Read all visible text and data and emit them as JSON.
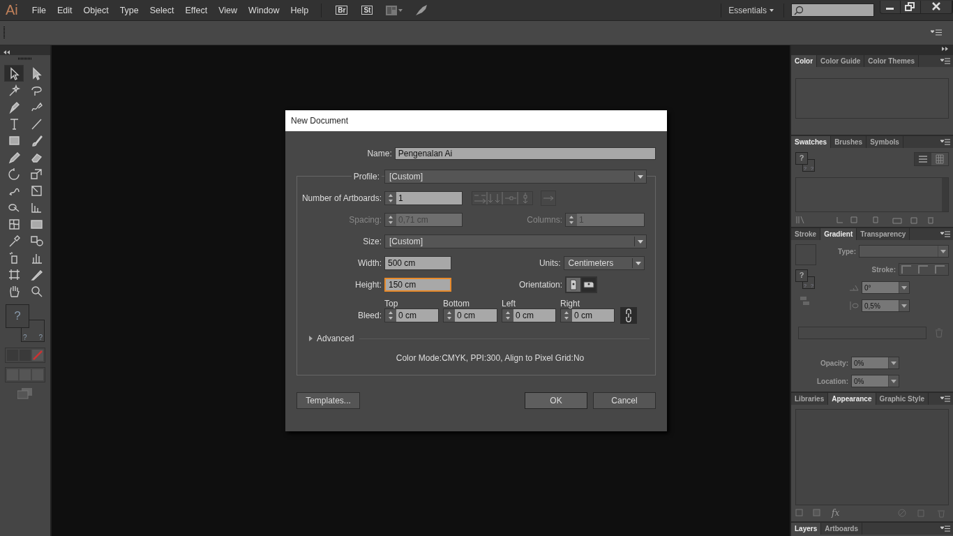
{
  "menubar": {
    "logo": "Ai",
    "menus": [
      "File",
      "Edit",
      "Object",
      "Type",
      "Select",
      "Effect",
      "View",
      "Window",
      "Help"
    ],
    "bridge": "Br",
    "stock": "St",
    "workspace": "Essentials"
  },
  "tools": [
    {
      "kind": "selection",
      "selected": true
    },
    {
      "kind": "direct",
      "selected": false
    },
    {
      "kind": "wand",
      "selected": false
    },
    {
      "kind": "lasso",
      "selected": false
    },
    {
      "kind": "pen",
      "selected": false
    },
    {
      "kind": "curvature",
      "selected": false
    },
    {
      "kind": "type",
      "selected": false
    },
    {
      "kind": "line",
      "selected": false
    },
    {
      "kind": "rectangle",
      "selected": false
    },
    {
      "kind": "brush",
      "selected": false
    },
    {
      "kind": "pencil",
      "selected": false
    },
    {
      "kind": "eraser",
      "selected": false
    },
    {
      "kind": "rotate",
      "selected": false
    },
    {
      "kind": "scale",
      "selected": false
    },
    {
      "kind": "warp",
      "selected": false
    },
    {
      "kind": "transform",
      "selected": false
    },
    {
      "kind": "shapebuilder",
      "selected": false
    },
    {
      "kind": "perspective",
      "selected": false
    },
    {
      "kind": "mesh",
      "selected": false
    },
    {
      "kind": "gradient",
      "selected": false
    },
    {
      "kind": "eyedropper",
      "selected": false
    },
    {
      "kind": "blend",
      "selected": false
    },
    {
      "kind": "sprayer",
      "selected": false
    },
    {
      "kind": "graph",
      "selected": false
    },
    {
      "kind": "artboard",
      "selected": false
    },
    {
      "kind": "slice",
      "selected": false
    },
    {
      "kind": "hand",
      "selected": false
    },
    {
      "kind": "zoom",
      "selected": false
    }
  ],
  "toolbox_fill": {
    "fill": "?",
    "stroke": "?",
    "other": "?"
  },
  "dialog": {
    "title": "New Document",
    "name": {
      "label": "Name:",
      "value": "Pengenalan Ai"
    },
    "profile": {
      "label": "Profile:",
      "value": "[Custom]"
    },
    "artboards": {
      "label": "Number of Artboards:",
      "value": "1"
    },
    "spacing": {
      "label": "Spacing:",
      "value": "0,71 cm",
      "disabled": true
    },
    "columns": {
      "label": "Columns:",
      "value": "1",
      "disabled": true
    },
    "size": {
      "label": "Size:",
      "value": "[Custom]"
    },
    "width": {
      "label": "Width:",
      "value": "500 cm"
    },
    "units": {
      "label": "Units:",
      "value": "Centimeters"
    },
    "height": {
      "label": "Height:",
      "value": "150 cm",
      "focused": true
    },
    "orientation": {
      "label": "Orientation:",
      "options": [
        {
          "kind": "portrait",
          "selected": false
        },
        {
          "kind": "landscape",
          "selected": true
        }
      ]
    },
    "bleed": {
      "label": "Bleed:",
      "sides": [
        {
          "label": "Top",
          "value": "0 cm"
        },
        {
          "label": "Bottom",
          "value": "0 cm"
        },
        {
          "label": "Left",
          "value": "0 cm"
        },
        {
          "label": "Right",
          "value": "0 cm"
        }
      ]
    },
    "advanced": {
      "label": "Advanced",
      "expanded": false
    },
    "summary": "Color Mode:CMYK, PPI:300, Align to Pixel Grid:No",
    "buttons": [
      {
        "label": "Templates...",
        "default": false
      },
      {
        "label": "OK",
        "default": true
      },
      {
        "label": "Cancel",
        "default": false
      }
    ]
  },
  "panels": {
    "color": {
      "tabs": [
        {
          "label": "Color",
          "selected": true
        },
        {
          "label": "Color Guide",
          "selected": false
        },
        {
          "label": "Color Themes",
          "selected": false
        }
      ]
    },
    "swatches": {
      "tabs": [
        {
          "label": "Swatches",
          "selected": true
        },
        {
          "label": "Brushes",
          "selected": false
        },
        {
          "label": "Symbols",
          "selected": false
        }
      ],
      "fill": {
        "fill": "?",
        "stroke": "?",
        "other": "?"
      },
      "views": [
        {
          "kind": "list",
          "selected": true
        },
        {
          "kind": "grid",
          "selected": false
        }
      ]
    },
    "gradient": {
      "tabs": [
        {
          "label": "Stroke",
          "selected": false
        },
        {
          "label": "Gradient",
          "selected": true
        },
        {
          "label": "Transparency",
          "selected": false
        }
      ],
      "fill": {
        "fill": "?",
        "stroke": "?",
        "other": "?"
      },
      "type_label": "Type:",
      "stroke_label": "Stroke:",
      "angle": "0°",
      "aspect": "0,5%",
      "opacity_label": "Opacity:",
      "opacity": "0%",
      "location_label": "Location:",
      "location": "0%"
    },
    "appearance": {
      "tabs": [
        {
          "label": "Libraries",
          "selected": false
        },
        {
          "label": "Appearance",
          "selected": true
        },
        {
          "label": "Graphic Style",
          "selected": false
        }
      ],
      "fx": "fx"
    },
    "layers": {
      "tabs": [
        {
          "label": "Layers",
          "selected": true
        },
        {
          "label": "Artboards",
          "selected": false
        }
      ]
    }
  }
}
